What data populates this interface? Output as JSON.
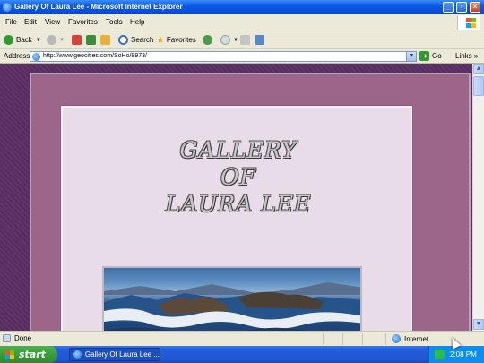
{
  "window": {
    "title": "Gallery Of Laura Lee - Microsoft Internet Explorer"
  },
  "menu": [
    "File",
    "Edit",
    "View",
    "Favorites",
    "Tools",
    "Help"
  ],
  "toolbar": {
    "back_label": "Back",
    "search_label": "Search",
    "favorites_label": "Favorites"
  },
  "address": {
    "label": "Address",
    "url": "http://www.geocities.com/SoHo/8973/",
    "go_label": "Go",
    "links_label": "Links"
  },
  "page": {
    "title_lines": [
      "GALLERY",
      "OF",
      "LAURA LEE"
    ],
    "colors": {
      "background": "#5b2d64",
      "frame": "#9b6689",
      "panel": "#e9dce9"
    }
  },
  "status": {
    "left": "Done",
    "zone": "Internet"
  },
  "taskbar": {
    "start_label": "start",
    "task_label": "Gallery Of Laura Lee ...",
    "clock": "2:08 PM"
  }
}
